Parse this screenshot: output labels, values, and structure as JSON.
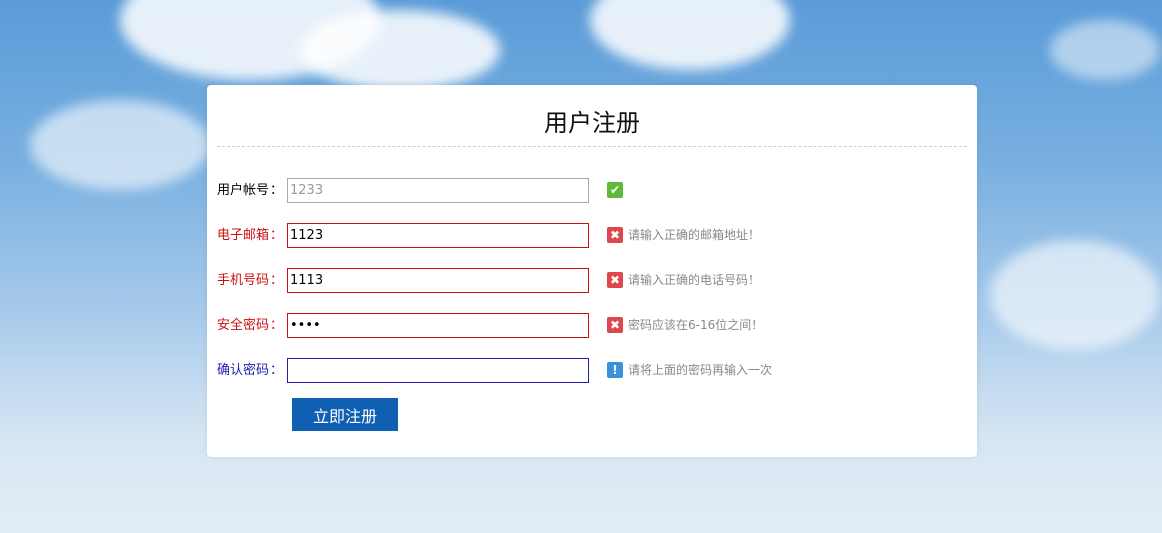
{
  "form": {
    "title": "用户注册",
    "submit_label": "立即注册",
    "fields": [
      {
        "label": "用户帐号",
        "value": "1233",
        "status": "ok",
        "message": ""
      },
      {
        "label": "电子邮箱",
        "value": "1123",
        "status": "error",
        "message": "请输入正确的邮箱地址！"
      },
      {
        "label": "手机号码",
        "value": "1113",
        "status": "error",
        "message": "请输入正确的电话号码！"
      },
      {
        "label": "安全密码",
        "value": "••••",
        "status": "error",
        "message": "密码应该在6-16位之间！"
      },
      {
        "label": "确认密码",
        "value": "",
        "status": "info",
        "message": "请将上面的密码再输入一次"
      }
    ],
    "colon": "："
  },
  "colors": {
    "error": "#cc1111",
    "focus": "#1f1faa",
    "ok_icon": "#5fb93a",
    "error_icon": "#e0474c",
    "info_icon": "#3a92db",
    "submit_bg": "#0f5fb3"
  },
  "icons": {
    "ok": "check-icon",
    "error": "close-icon",
    "info": "exclamation-icon"
  }
}
